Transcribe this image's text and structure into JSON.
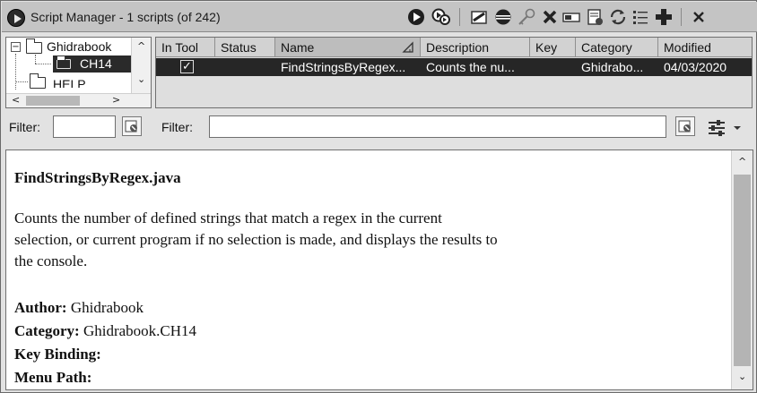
{
  "window": {
    "title": "Script Manager - 1 scripts  (of 242)"
  },
  "toolbar": {
    "icons": [
      "run-script-icon",
      "run-last-icon",
      "edit-script-icon",
      "eclipse-icon",
      "key-binding-icon",
      "delete-icon",
      "rename-icon",
      "new-script-icon",
      "refresh-icon",
      "script-dirs-icon",
      "help-icon",
      "close-icon"
    ]
  },
  "tree": {
    "root": "Ghidrabook",
    "child": "CH14",
    "partial": "HELP"
  },
  "table": {
    "headers": [
      "In Tool",
      "Status",
      "Name",
      "Description",
      "Key",
      "Category",
      "Modified"
    ],
    "rows": [
      {
        "in_tool": "✓",
        "status": "",
        "name": "FindStringsByRegex...",
        "description": "Counts the nu...",
        "key": "",
        "category": "Ghidrabo...",
        "modified": "04/03/2020"
      }
    ]
  },
  "filters": {
    "tree_label": "Filter:",
    "tree_value": "",
    "table_label": "Filter:",
    "table_value": ""
  },
  "details": {
    "script_name": "FindStringsByRegex.java",
    "description": "Counts the number of defined strings that match a regex in the current selection, or current program if no selection is made, and displays the results to the console.",
    "author_label": "Author:",
    "author": "Ghidrabook",
    "category_label": "Category:",
    "category": "Ghidrabook.CH14",
    "key_binding_label": "Key Binding:",
    "key_binding": "",
    "menu_path_label": "Menu Path:",
    "menu_path": ""
  }
}
